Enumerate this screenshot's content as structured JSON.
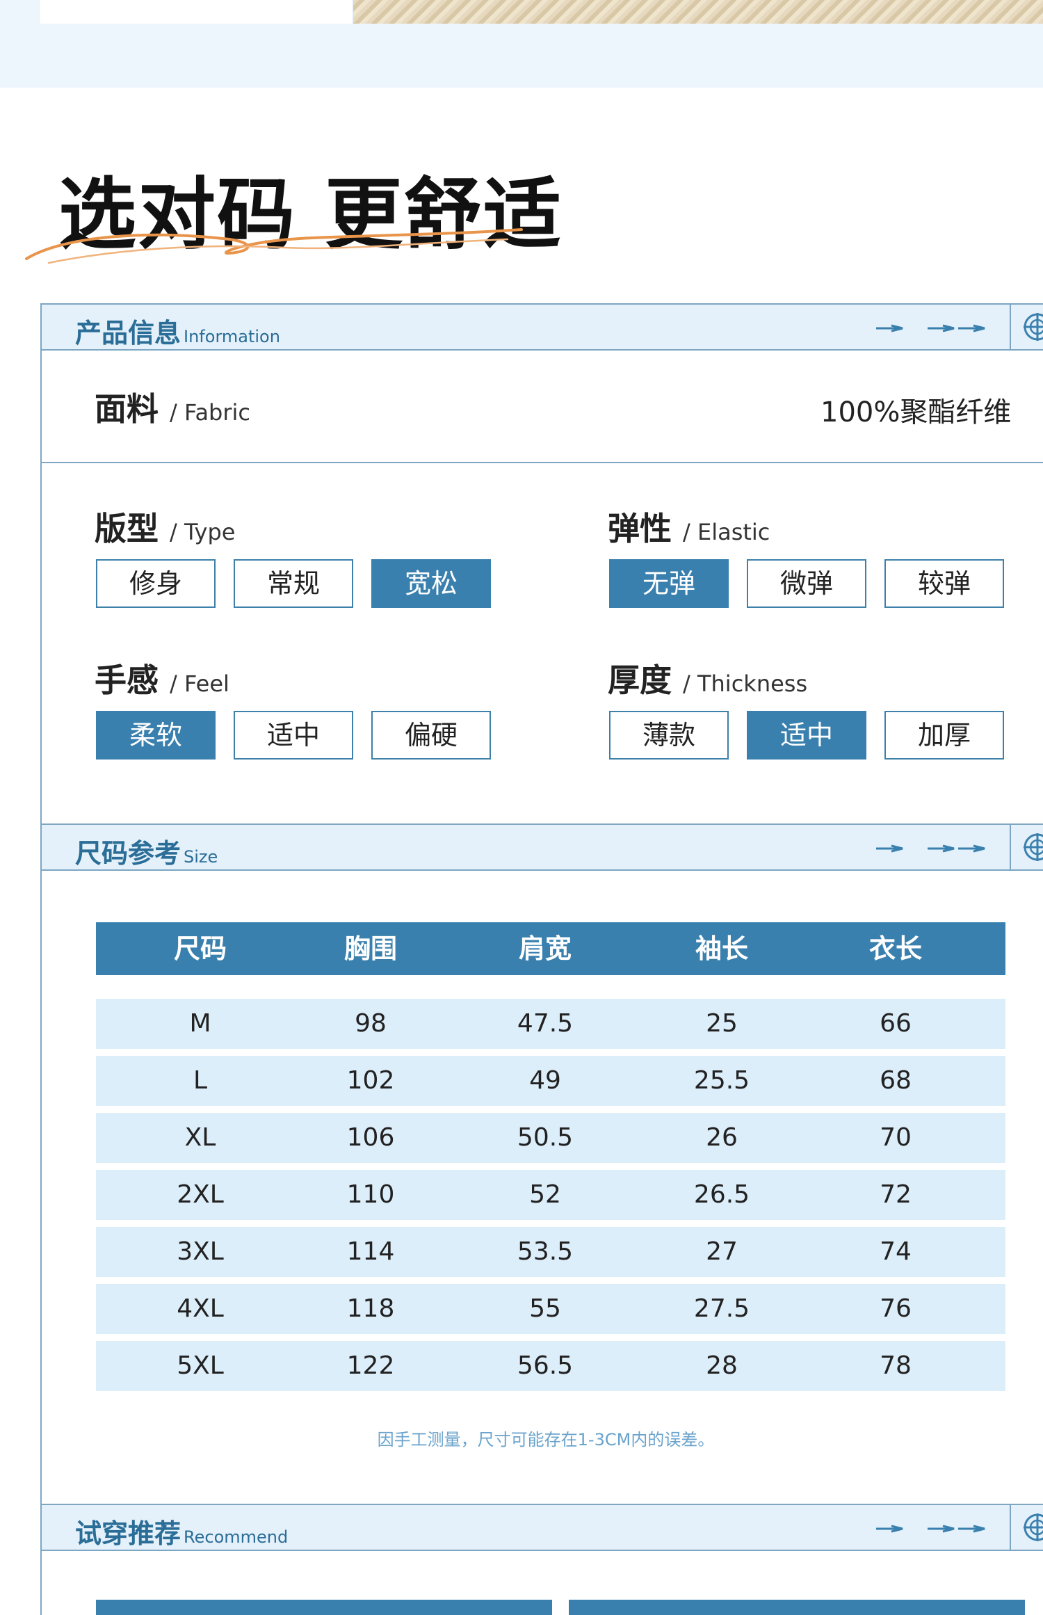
{
  "headline": "选对码 更舒适",
  "sections": {
    "info": {
      "title_cn": "产品信息",
      "title_en": "Information"
    },
    "size": {
      "title_cn": "尺码参考",
      "title_en": "Size"
    },
    "recommend": {
      "title_cn": "试穿推荐",
      "title_en": "Recommend"
    }
  },
  "fabric": {
    "label_cn": "面料",
    "label_en": "/ Fabric",
    "value": "100%聚酯纤维"
  },
  "attributes": {
    "type": {
      "label_cn": "版型",
      "label_en": "/ Type",
      "options": [
        "修身",
        "常规",
        "宽松"
      ],
      "selected": 2
    },
    "elastic": {
      "label_cn": "弹性",
      "label_en": "/ Elastic",
      "options": [
        "无弹",
        "微弹",
        "较弹"
      ],
      "selected": 0
    },
    "feel": {
      "label_cn": "手感",
      "label_en": "/ Feel",
      "options": [
        "柔软",
        "适中",
        "偏硬"
      ],
      "selected": 0
    },
    "thickness": {
      "label_cn": "厚度",
      "label_en": "/ Thickness",
      "options": [
        "薄款",
        "适中",
        "加厚"
      ],
      "selected": 1
    }
  },
  "size_table": {
    "headers": [
      "尺码",
      "胸围",
      "肩宽",
      "袖长",
      "衣长"
    ],
    "rows": [
      [
        "M",
        "98",
        "47.5",
        "25",
        "66"
      ],
      [
        "L",
        "102",
        "49",
        "25.5",
        "68"
      ],
      [
        "XL",
        "106",
        "50.5",
        "26",
        "70"
      ],
      [
        "2XL",
        "110",
        "52",
        "26.5",
        "72"
      ],
      [
        "3XL",
        "114",
        "53.5",
        "27",
        "74"
      ],
      [
        "4XL",
        "118",
        "55",
        "27.5",
        "76"
      ],
      [
        "5XL",
        "122",
        "56.5",
        "28",
        "78"
      ]
    ],
    "note": "因手工测量，尺寸可能存在1-3CM内的误差。"
  },
  "colors": {
    "accent": "#3a80ae",
    "header_bg": "#e4f0fa",
    "row_bg": "#ddeefb",
    "title": "#2a6d97",
    "swoosh": "#e8944a"
  }
}
